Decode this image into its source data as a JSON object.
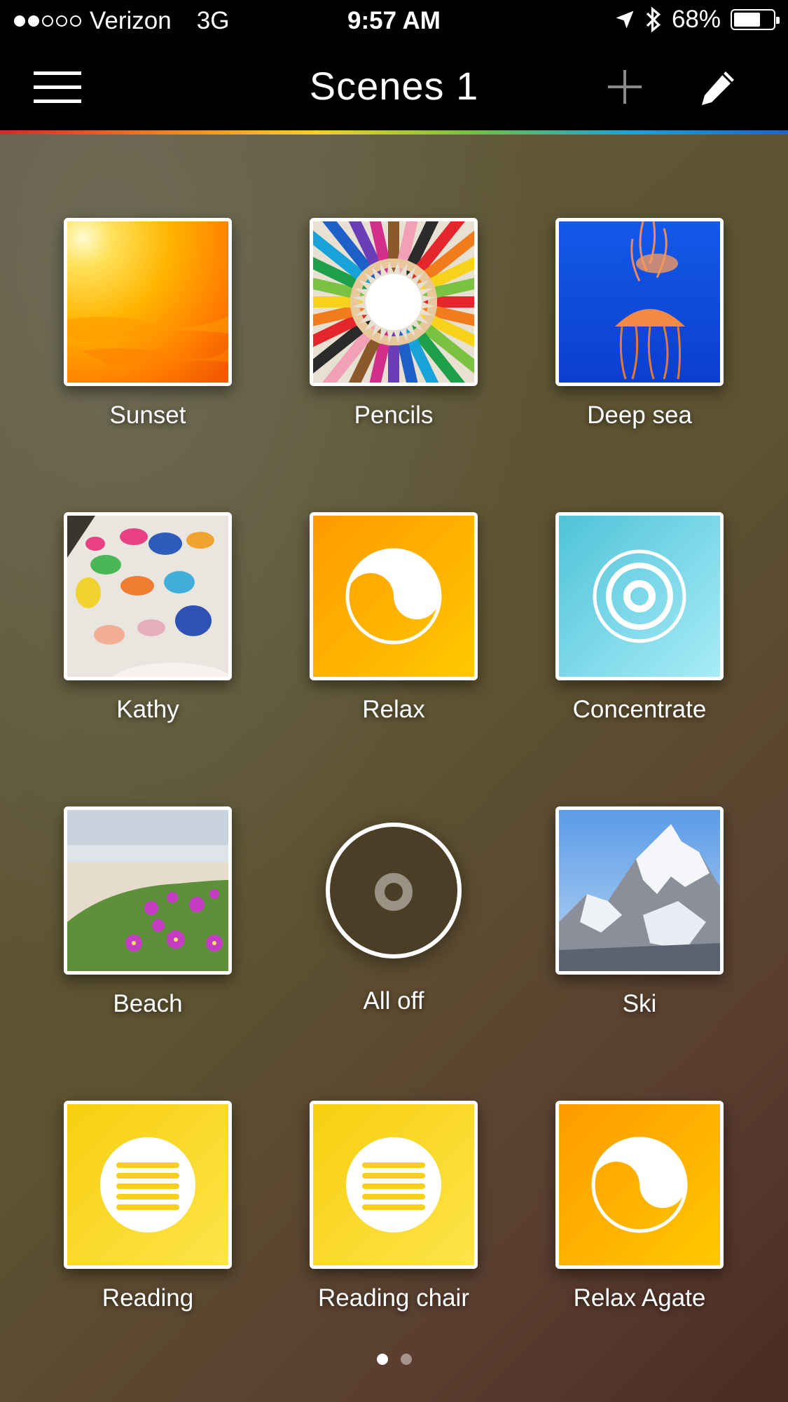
{
  "status_bar": {
    "carrier": "Verizon",
    "network": "3G",
    "time": "9:57 AM",
    "battery": "68%",
    "battery_level": 0.68,
    "signal_strength": 2,
    "signal_max": 5,
    "icons": [
      "location-arrow-icon",
      "bluetooth-icon",
      "battery-icon"
    ]
  },
  "nav": {
    "title": "Scenes 1",
    "menu_icon": "hamburger-menu-icon",
    "add_icon": "plus-icon",
    "edit_icon": "pencil-icon"
  },
  "scenes": [
    {
      "label": "Sunset",
      "kind": "photo",
      "image": "sunset"
    },
    {
      "label": "Pencils",
      "kind": "photo",
      "image": "pencils"
    },
    {
      "label": "Deep sea",
      "kind": "photo",
      "image": "jellyfish"
    },
    {
      "label": "Kathy",
      "kind": "photo",
      "image": "handprints"
    },
    {
      "label": "Relax",
      "kind": "icon",
      "icon": "relax-icon"
    },
    {
      "label": "Concentrate",
      "kind": "icon",
      "icon": "concentrate-icon"
    },
    {
      "label": "Beach",
      "kind": "photo",
      "image": "beach-flowers"
    },
    {
      "label": "All off",
      "kind": "power",
      "icon": "power-off-icon"
    },
    {
      "label": "Ski",
      "kind": "photo",
      "image": "snowy-mountain"
    },
    {
      "label": "Reading",
      "kind": "icon",
      "icon": "reading-icon"
    },
    {
      "label": "Reading chair",
      "kind": "icon",
      "icon": "reading-icon"
    },
    {
      "label": "Relax Agate",
      "kind": "icon",
      "icon": "relax-icon"
    }
  ],
  "pager": {
    "pages": 2,
    "current": 1
  },
  "colors": {
    "nav_bg": "#000000",
    "relax_orange": "#ffa400",
    "concentrate_blue": "#6fd3e6",
    "reading_yellow": "#fcd81a"
  }
}
